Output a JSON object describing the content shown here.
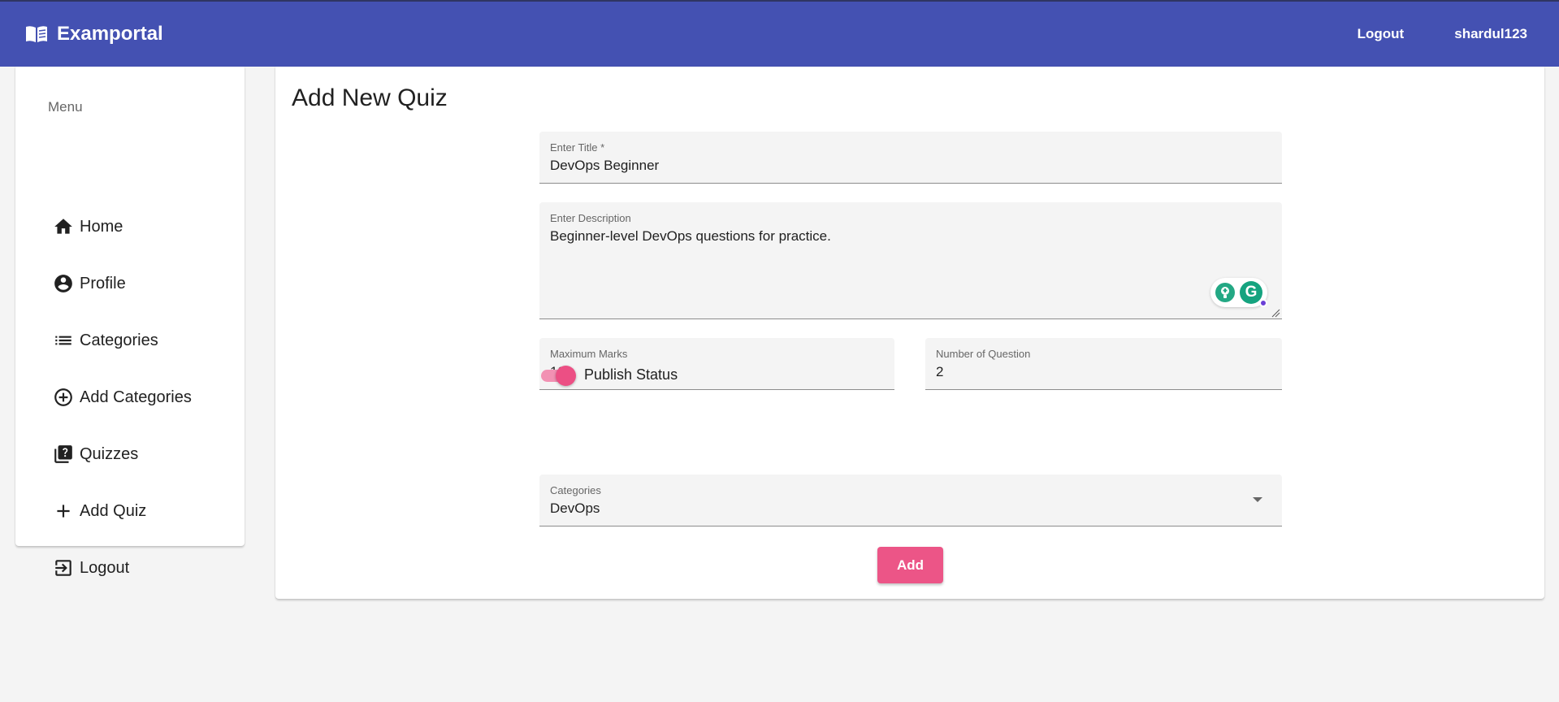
{
  "header": {
    "app_name": "Examportal",
    "logout_label": "Logout",
    "username": "shardul123",
    "bg_color": "#4451b2"
  },
  "sidebar": {
    "menu_title": "Menu",
    "items": [
      {
        "label": "Home",
        "icon": "home-icon"
      },
      {
        "label": "Profile",
        "icon": "account-circle-icon"
      },
      {
        "label": "Categories",
        "icon": "list-icon"
      },
      {
        "label": "Add Categories",
        "icon": "add-circle-outline-icon"
      },
      {
        "label": "Quizzes",
        "icon": "quiz-icon"
      },
      {
        "label": "Add Quiz",
        "icon": "add-icon"
      },
      {
        "label": "Logout",
        "icon": "logout-icon"
      }
    ]
  },
  "main": {
    "title": "Add New Quiz",
    "form": {
      "title_field": {
        "label": "Enter Title *",
        "value": "DevOps Beginner"
      },
      "description_field": {
        "label": "Enter Description",
        "value": "Beginner-level DevOps questions for practice."
      },
      "max_marks_field": {
        "label": "Maximum Marks",
        "value": "10"
      },
      "num_questions_field": {
        "label": "Number of Question",
        "value": "2"
      },
      "publish": {
        "label": "Publish Status",
        "checked": true
      },
      "categories_field": {
        "label": "Categories",
        "value": "DevOps"
      },
      "submit_label": "Add"
    }
  },
  "colors": {
    "accent": "#ec5587",
    "primary": "#4451b2"
  }
}
